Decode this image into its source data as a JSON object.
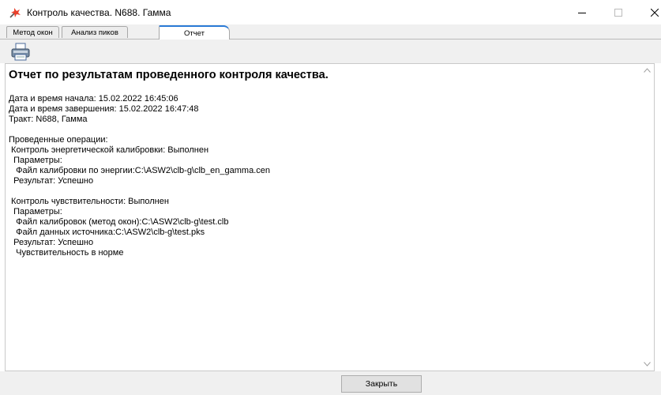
{
  "window": {
    "title": "Контроль качества. N688. Гамма",
    "controls": {
      "minimize": "minimize-icon",
      "maximize": "maximize-icon",
      "close": "close-icon"
    }
  },
  "tabs": [
    {
      "label": "Метод окон",
      "active": false
    },
    {
      "label": "Анализ пиков",
      "active": false
    },
    {
      "label": "Отчет",
      "active": true
    }
  ],
  "toolbar": {
    "print_icon": "printer-icon"
  },
  "report": {
    "title": "Отчет по результатам проведенного контроля качества.",
    "start_time": "Дата и время начала: 15.02.2022 16:45:06",
    "end_time": "Дата и время завершения: 15.02.2022 16:47:48",
    "tract": "Тракт: N688, Гамма",
    "operations_header": "Проведенные операции:",
    "operations": [
      {
        "name": " Контроль энергетической калибровки: Выполнен",
        "params_label": "  Параметры:",
        "params": [
          "   Файл калибровки по энергии:C:\\ASW2\\clb-g\\clb_en_gamma.cen"
        ],
        "result": "  Результат: Успешно",
        "extra": []
      },
      {
        "name": " Контроль чувствительности: Выполнен",
        "params_label": "  Параметры:",
        "params": [
          "   Файл калибровок (метод окон):C:\\ASW2\\clb-g\\test.clb",
          "   Файл данных источника:C:\\ASW2\\clb-g\\test.pks"
        ],
        "result": "  Результат: Успешно",
        "extra": [
          "   Чувствительность в норме"
        ]
      }
    ]
  },
  "footer": {
    "close_label": "Закрыть"
  },
  "colors": {
    "active_tab_accent": "#2a7ad6",
    "panel_bg": "#f0f0f0",
    "app_icon": "#e8412c"
  }
}
